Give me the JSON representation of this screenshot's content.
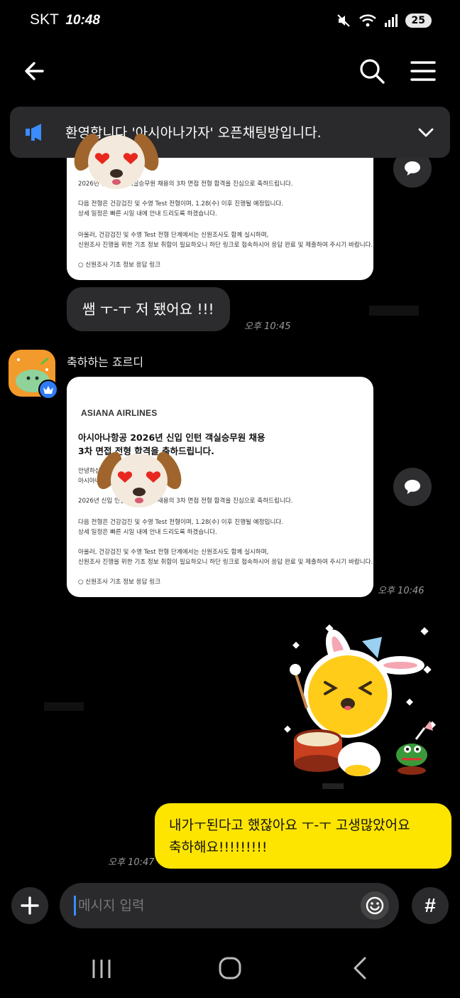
{
  "status_bar": {
    "carrier": "SKT",
    "time": "10:48",
    "battery": "25"
  },
  "notice": {
    "text": "환영합니다 '아시아나가자' 오픈채팅방입니다."
  },
  "messages": {
    "card1": {
      "lines": [
        "2026년 신입 인턴 객실승무원 채용의 3차 면접 전형 합격을 진심으로 축하드립니다.",
        "다음 전형은 건강검진 및 수영 Test 전형이며, 1.28(수) 이후 진행될 예정입니다.",
        "상세 일정은 빠른 시일 내에 안내 드리도록 하겠습니다.",
        "아울러, 건강검진 및 수영 Test 전형 단계에서는 신원조사도 함께 실시하며,",
        "신원조사 진행을 위한 기초 정보 취합이 필요하오니 하단 링크로 접속하시어 응답 완료 및 제출하여 주시기 바랍니다.",
        "○ 신원조사 기초 정보 응답 링크"
      ]
    },
    "my_reply": {
      "text": "쌤 ㅜ-ㅜ 저 됐어요 !!!",
      "time": "오후 10:45"
    },
    "sender": {
      "name": "축하하는 죠르디"
    },
    "card2": {
      "brand": "ASIANA AIRLINES",
      "title_line1": "아시아나항공 2026년 신입 인턴 객실승무원 채용",
      "title_line2": "3차 면접 전형 합격을 축하드립니다.",
      "greeting1": "안녕하십니까.",
      "greeting2": "아시아나항공입니다.",
      "lines": [
        "2026년 신입 인턴 객실승무원 채용의 3차 면접 전형 합격을 진심으로 축하드립니다.",
        "다음 전형은 건강검진 및 수영 Test 전형이며, 1.28(수) 이후 진행될 예정입니다.",
        "상세 일정은 빠른 시일 내에 안내 드리도록 하겠습니다.",
        "아울러, 건강검진 및 수영 Test 전형 단계에서는 신원조사도 함께 실시하며,",
        "신원조사 진행을 위한 기초 정보 취합이 필요하오니 하단 링크로 접속하시어 응답 완료 및 제출하여 주시기 바랍니다.",
        "○ 신원조사 기초 정보 응답 링크"
      ],
      "time": "오후 10:46"
    },
    "yellow": {
      "line1": "내가ㅜ된다고 했잖아요 ㅜ-ㅜ 고생많았어요",
      "line2": "축하해요!!!!!!!!!",
      "time": "오후 10:47"
    }
  },
  "composer": {
    "placeholder": "메시지 입력",
    "hash": "#"
  },
  "colors": {
    "bubble_yellow": "#fee500",
    "bubble_gray": "#2c2c2e",
    "accent_blue": "#2f7cf6"
  }
}
